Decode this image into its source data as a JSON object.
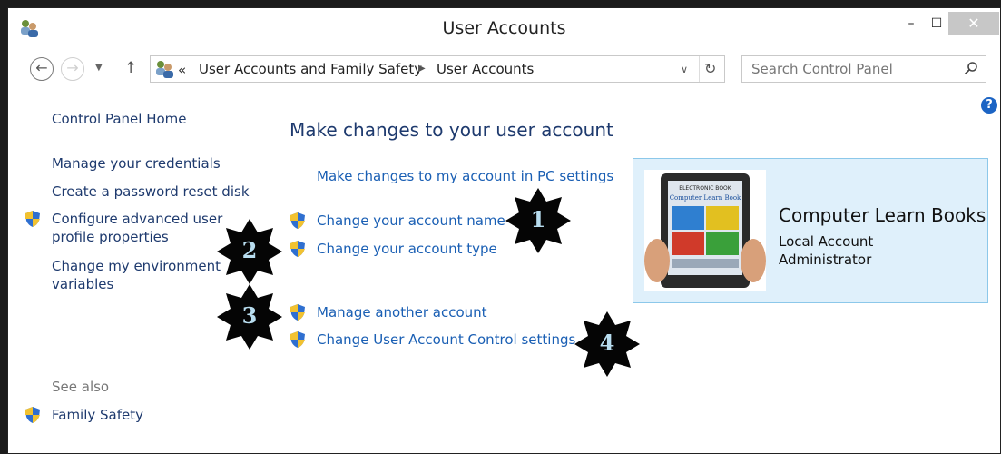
{
  "window": {
    "title": "User Accounts",
    "close_glyph": "✕",
    "minimize_glyph": "–",
    "maximize_glyph": "☐"
  },
  "nav": {
    "back_glyph": "←",
    "forward_glyph": "→",
    "up_glyph": "↑",
    "breadcrumb_chevron": "«",
    "breadcrumb": [
      "User Accounts and Family Safety",
      "User Accounts"
    ],
    "search_placeholder": "Search Control Panel"
  },
  "sidebar": {
    "links": [
      "Control Panel Home",
      "Manage your credentials",
      "Create a password reset disk",
      "Configure advanced user profile properties",
      "Change my environment variables"
    ],
    "see_also_label": "See also",
    "see_also_links": [
      "Family Safety"
    ]
  },
  "main": {
    "heading": "Make changes to your user account",
    "tasks": [
      "Make changes to my account in PC settings",
      "Change your account name",
      "Change your account type",
      "Manage another account",
      "Change User Account Control settings"
    ]
  },
  "account": {
    "name": "Computer Learn Books",
    "type": "Local Account",
    "role": "Administrator",
    "picture_caption_top": "ELECTRONIC BOOK",
    "picture_caption_title": "Computer Learn Book"
  },
  "badges": [
    "1",
    "2",
    "3",
    "4"
  ],
  "colors": {
    "link": "#1a5fb4",
    "heading": "#1e3a6e",
    "panel_bg": "#dff0fb",
    "panel_border": "#8cc8ea",
    "help": "#1c64c4",
    "badge_text": "#b8ddef"
  },
  "icons": [
    "user-accounts-icon",
    "shield-icon",
    "search-icon",
    "help-icon",
    "refresh-icon"
  ]
}
